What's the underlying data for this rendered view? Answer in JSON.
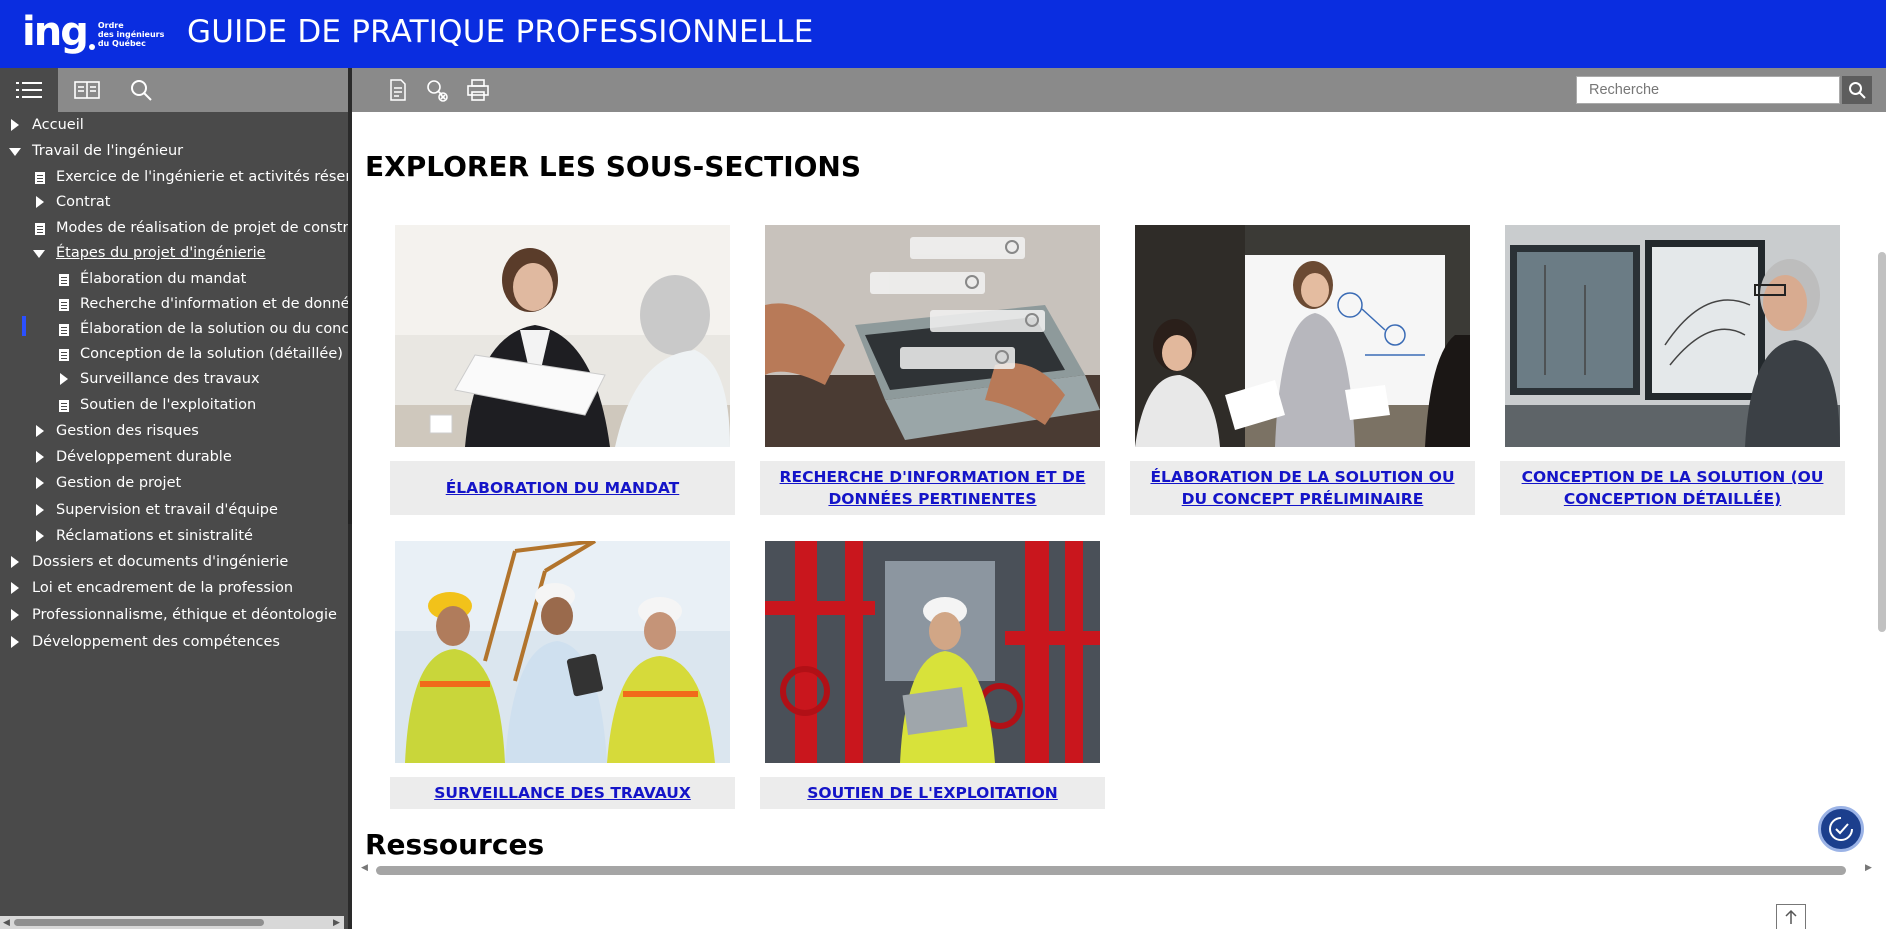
{
  "header": {
    "logo_main": "ing",
    "logo_sub": [
      "Ordre",
      "des ingénieurs",
      "du Québec"
    ],
    "title": "GUIDE DE PRATIQUE PROFESSIONNELLE",
    "bg_color": "#0a2de0"
  },
  "sidebar": {
    "tabs": [
      {
        "icon": "toc-list-icon",
        "active": true
      },
      {
        "icon": "book-icon",
        "active": false
      },
      {
        "icon": "search-icon",
        "active": false
      }
    ],
    "tree": [
      {
        "label": "Accueil",
        "level": 0,
        "icon": "expand-icon"
      },
      {
        "label": "Travail de l'ingénieur",
        "level": 0,
        "icon": "collapse-icon"
      },
      {
        "label": "Exercice de l'ingénierie et activités réservées",
        "level": 1,
        "icon": "document-icon"
      },
      {
        "label": "Contrat",
        "level": 1,
        "icon": "expand-icon"
      },
      {
        "label": "Modes de réalisation de projet de construction",
        "level": 1,
        "icon": "document-icon"
      },
      {
        "label": "Étapes du projet d'ingénierie",
        "level": 1,
        "icon": "collapse-icon",
        "current": true
      },
      {
        "label": "Élaboration du mandat",
        "level": 2,
        "icon": "document-icon"
      },
      {
        "label": "Recherche d'information et de données pertinentes",
        "level": 2,
        "icon": "document-icon"
      },
      {
        "label": "Élaboration de la solution ou du concept préliminaire",
        "level": 2,
        "icon": "document-icon"
      },
      {
        "label": "Conception de la solution (détaillée)",
        "level": 2,
        "icon": "document-icon"
      },
      {
        "label": "Surveillance des travaux",
        "level": 2,
        "icon": "expand-icon"
      },
      {
        "label": "Soutien de l'exploitation",
        "level": 2,
        "icon": "document-icon"
      },
      {
        "label": "Gestion des risques",
        "level": 1,
        "icon": "expand-icon"
      },
      {
        "label": "Développement durable",
        "level": 1,
        "icon": "expand-icon"
      },
      {
        "label": "Gestion de projet",
        "level": 1,
        "icon": "expand-icon"
      },
      {
        "label": "Supervision et travail d'équipe",
        "level": 1,
        "icon": "expand-icon"
      },
      {
        "label": "Réclamations et sinistralité",
        "level": 1,
        "icon": "expand-icon"
      },
      {
        "label": "Dossiers et documents d'ingénierie",
        "level": 0,
        "icon": "expand-icon"
      },
      {
        "label": "Loi et encadrement de la profession",
        "level": 0,
        "icon": "expand-icon"
      },
      {
        "label": "Professionnalisme, éthique et déontologie",
        "level": 0,
        "icon": "expand-icon"
      },
      {
        "label": "Développement des compétences",
        "level": 0,
        "icon": "expand-icon"
      }
    ]
  },
  "toolbar": {
    "icons": [
      "pdf-export-icon",
      "clear-highlight-icon",
      "print-icon"
    ],
    "search_placeholder": "Recherche"
  },
  "main": {
    "section_title": "EXPLORER LES SOUS-SECTIONS",
    "cards": [
      {
        "caption": "ÉLABORATION DU MANDAT",
        "image": "meeting-photo"
      },
      {
        "caption": "RECHERCHE D'INFORMATION ET DE DONNÉES PERTINENTES",
        "image": "laptop-search-photo"
      },
      {
        "caption": "ÉLABORATION DE LA SOLUTION OU DU CONCEPT PRÉLIMINAIRE",
        "image": "whiteboard-presentation-photo"
      },
      {
        "caption": "CONCEPTION DE LA SOLUTION (OU CONCEPTION DÉTAILLÉE)",
        "image": "design-screens-photo"
      },
      {
        "caption": "SURVEILLANCE DES TRAVAUX",
        "image": "construction-site-photo"
      },
      {
        "caption": "SOUTIEN DE L'EXPLOITATION",
        "image": "mechanical-room-photo"
      }
    ],
    "resources_title": "Ressources"
  },
  "colors": {
    "link": "#1414c8",
    "sidebar_bg": "#4a4a4a",
    "toolbar_bg": "#8a8a8a"
  }
}
